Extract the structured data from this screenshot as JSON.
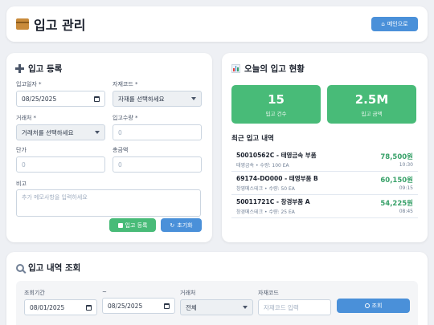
{
  "header": {
    "title": "입고 관리",
    "main_button": "메인으로",
    "icon": "package-icon"
  },
  "register": {
    "title": "입고 등록",
    "date_label": "입고일자 *",
    "date_value": "08/25/2025",
    "material_label": "자재코드 *",
    "material_value": "자재를 선택하세요",
    "vendor_label": "거래처 *",
    "vendor_value": "거래처를 선택하세요",
    "qty_label": "입고수량 *",
    "qty_placeholder": "0",
    "price_label": "단가",
    "price_placeholder": "0",
    "total_label": "총금액",
    "total_placeholder": "0",
    "memo_label": "비고",
    "memo_placeholder": "추가 메모사항을 입력하세요",
    "submit_button": "입고 등록",
    "reset_button": "초기화"
  },
  "today": {
    "title": "오늘의 입고 현황",
    "count_value": "15",
    "count_label": "입고 건수",
    "amount_value": "2.5M",
    "amount_label": "입고 금액",
    "recent_title": "최근 입고 내역",
    "items": [
      {
        "name": "50010562C - 태영금속 부품",
        "sub": "태영금속 • 수량: 100 EA",
        "amount": "78,500원",
        "time": "10:30"
      },
      {
        "name": "69174-DO000 - 태영부품 B",
        "sub": "창영메스테크 • 수량: 50 EA",
        "amount": "60,150원",
        "time": "09:15"
      },
      {
        "name": "50011721C - 창경부품 A",
        "sub": "창경메스테크 • 수량: 25 EA",
        "amount": "54,225원",
        "time": "08:45"
      }
    ]
  },
  "search": {
    "title": "입고 내역 조회",
    "period_label": "조회기간",
    "date_from": "08/01/2025",
    "tilde": "~",
    "date_to": "08/25/2025",
    "vendor_label": "거래처",
    "vendor_value": "전체",
    "material_label": "자재코드",
    "material_placeholder": "자재코드 입력",
    "search_button": "조회"
  },
  "colors": {
    "accent_blue": "#4a90d9",
    "accent_green": "#48bb78",
    "amount_green": "#38a169"
  }
}
